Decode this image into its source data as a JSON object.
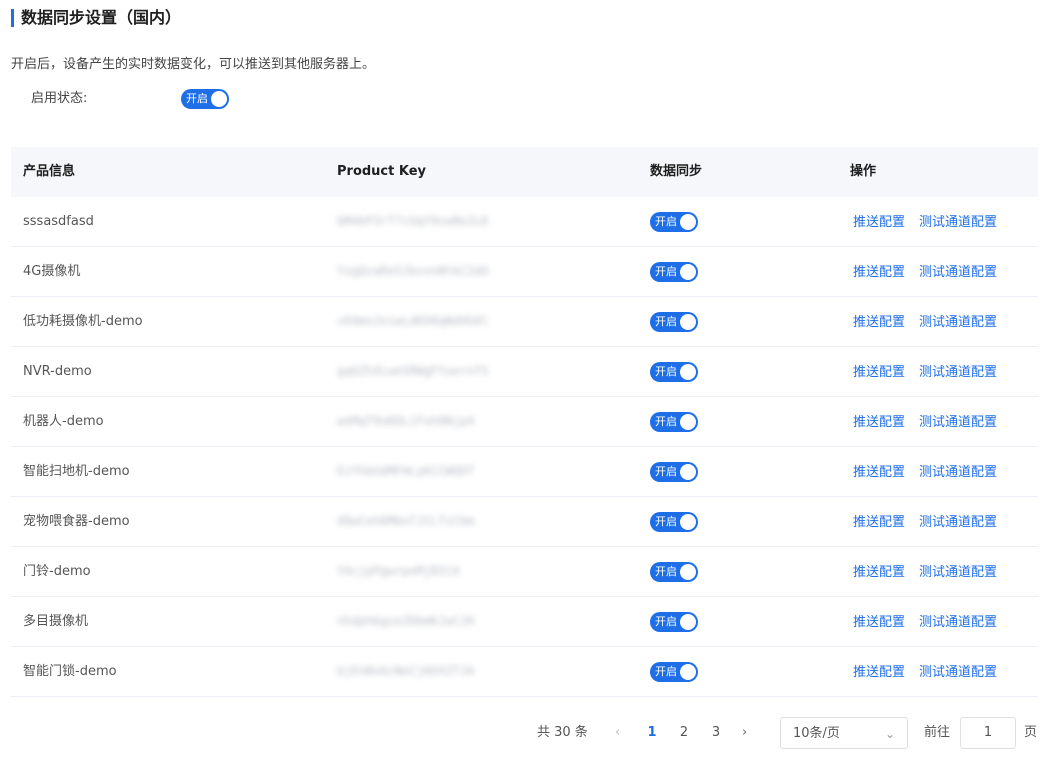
{
  "header": {
    "title": "数据同步设置（国内）",
    "description": "开启后，设备产生的实时数据变化，可以推送到其他服务器上。",
    "status_label": "启用状态:",
    "status_switch_text": "开启"
  },
  "table": {
    "columns": [
      "产品信息",
      "Product Key",
      "数据同步",
      "操作"
    ],
    "rows": [
      {
        "name": "sssasdfasd",
        "key": "bM4kP3rT7cUqY9vwNo2LK",
        "sync": "开启"
      },
      {
        "name": "4G摄像机",
        "key": "YsgQzaRe5JbvxnNtkC2dU",
        "sync": "开启"
      },
      {
        "name": "低功耗摄像机-demo",
        "key": "vO4mnJoiwLdKD8qNdHS8l",
        "sync": "开启"
      },
      {
        "name": "NVR-demo",
        "key": "gqGZhXLweSRWgFYuernTS",
        "sync": "开启"
      },
      {
        "name": "机器人-demo",
        "key": "woMqT9oKDLiFoh8Njp4",
        "sync": "开启"
      },
      {
        "name": "智能扫地机-demo",
        "key": "EzYhbGdMFmLyKCCWQDT",
        "sync": "开启"
      },
      {
        "name": "宠物喂食器-demo",
        "key": "dQwCeh6MboTJCLTsCbm",
        "sync": "开启"
      },
      {
        "name": "门铃-demo",
        "key": "YAcjpPgwrpoMjBICA",
        "sync": "开启"
      },
      {
        "name": "多目摄像机",
        "key": "nhdphbgseZDbmKJwCJH",
        "sync": "开启"
      },
      {
        "name": "智能门锁-demo",
        "key": "bjEnNsKcNeCjKDXZTJA",
        "sync": "开启"
      }
    ],
    "op_push": "推送配置",
    "op_test": "测试通道配置"
  },
  "pagination": {
    "total": "共 30 条",
    "prev": "‹",
    "pages": [
      "1",
      "2",
      "3"
    ],
    "active_page": "1",
    "next": "›",
    "page_size": "10条/页",
    "goto_label": "前往",
    "goto_value": "1",
    "page_unit": "页"
  },
  "colors": {
    "primary": "#1e6ee8",
    "header_bg": "#f5f7fa",
    "border": "#ebeef5"
  }
}
